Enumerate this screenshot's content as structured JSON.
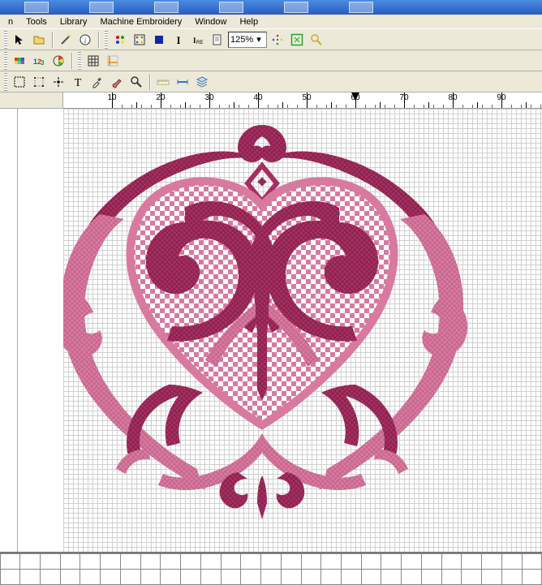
{
  "menus": [
    "n",
    "Tools",
    "Library",
    "Machine Embroidery",
    "Window",
    "Help"
  ],
  "zoom": "125%",
  "ruler": {
    "numbers": [
      10,
      20,
      30,
      40,
      50,
      60,
      70,
      80,
      90
    ],
    "marker_at": 60
  },
  "colors": {
    "dark": "#a72e61",
    "light": "#d87aa0",
    "white": "#ffffff"
  },
  "icons": {
    "cursor": "cursor-icon",
    "open": "folder-open-icon",
    "save": "save-disk-icon",
    "wand": "wand-icon",
    "info": "info-icon",
    "dot4": "four-dots-icon",
    "dot4b": "four-dots-b-icon",
    "square": "square-icon",
    "text-i": "text-i-icon",
    "text-ire": "text-ire-icon",
    "page": "page-icon",
    "zoom-dd": "zoom-dropdown",
    "cross": "cross-dots-icon",
    "move": "move-icon",
    "find": "magnifier-icon",
    "palette": "palette-icon",
    "123": "numbered-icon",
    "color-circle": "color-circle-icon",
    "grid": "grid-icon",
    "guides": "guides-icon",
    "sel-rect": "select-rect-icon",
    "sel-dots": "select-dots-icon",
    "point": "point-tool-icon",
    "text-t": "text-T-icon",
    "eyedrop": "eyedropper-icon",
    "brush": "brush-icon",
    "zoom-tool": "zoom-tool-icon",
    "measure": "measure-icon",
    "guide-line": "guide-line-icon",
    "layers": "layers-icon"
  },
  "footer_cols": 27
}
